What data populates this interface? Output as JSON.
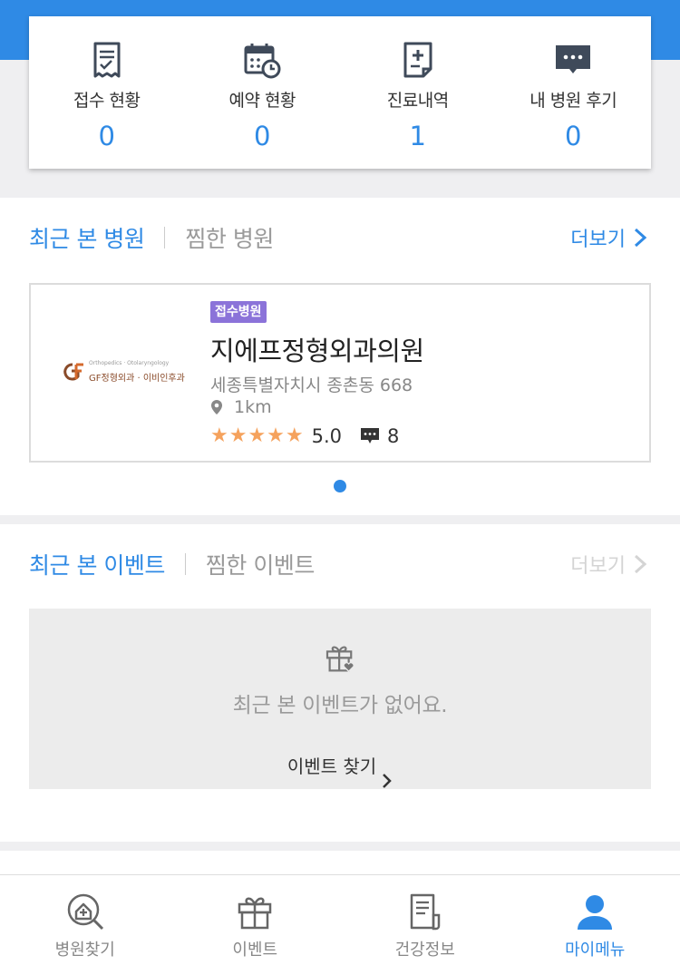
{
  "theme": {
    "accent": "#2f8ae5",
    "badge": "#8b73d9",
    "star": "#f5a25d"
  },
  "stats": [
    {
      "label": "접수 현황",
      "count": "0",
      "icon": "receipt-icon"
    },
    {
      "label": "예약 현황",
      "count": "0",
      "icon": "calendar-clock-icon"
    },
    {
      "label": "진료내역",
      "count": "1",
      "icon": "medical-record-icon"
    },
    {
      "label": "내 병원 후기",
      "count": "0",
      "icon": "chat-bubble-icon"
    }
  ],
  "hospitals_section": {
    "tab_active": "최근 본 병원",
    "tab_inactive": "찜한 병원",
    "more": "더보기",
    "card": {
      "logo_text": "GF정형외과 · 이비인후과",
      "logo_subtext": "Orthopedics · Otolaryngology",
      "badge": "접수병원",
      "name": "지에프정형외과의원",
      "address": "세종특별자치시 종촌동 668",
      "distance": "1km",
      "stars": "★★★★★",
      "rating": "5.0",
      "review_count": "8"
    }
  },
  "events_section": {
    "tab_active": "최근 본 이벤트",
    "tab_inactive": "찜한 이벤트",
    "more": "더보기",
    "empty_text": "최근 본 이벤트가 없어요.",
    "find_link": "이벤트 찾기"
  },
  "tabbar": [
    {
      "label": "병원찾기",
      "icon": "hospital-search-icon",
      "active": false
    },
    {
      "label": "이벤트",
      "icon": "gift-icon",
      "active": false
    },
    {
      "label": "건강정보",
      "icon": "health-doc-icon",
      "active": false
    },
    {
      "label": "마이메뉴",
      "icon": "person-icon",
      "active": true
    }
  ]
}
